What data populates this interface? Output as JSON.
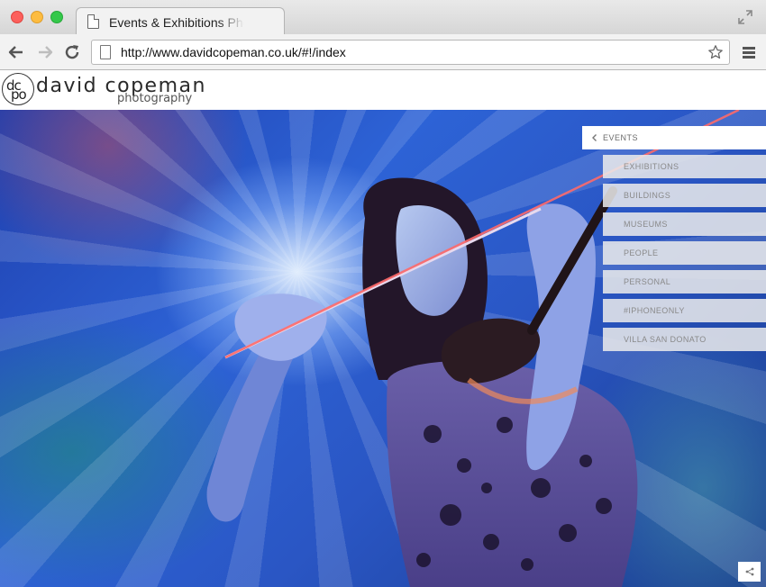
{
  "browser": {
    "tab_title": "Events & Exhibitions Photography",
    "url": "http://www.davidcopeman.co.uk/#!/index"
  },
  "site": {
    "logo_mark_top": "dc",
    "logo_mark_bottom": "po",
    "name": "david copeman",
    "tagline": "photography"
  },
  "menu": {
    "header": "EVENTS",
    "items": [
      {
        "label": "EXHIBITIONS"
      },
      {
        "label": "BUILDINGS"
      },
      {
        "label": "MUSEUMS"
      },
      {
        "label": "PEOPLE"
      },
      {
        "label": "PERSONAL"
      },
      {
        "label": "#IPHONEONLY"
      },
      {
        "label": "VILLA SAN DONATO"
      }
    ]
  },
  "icons": {
    "tab": "document-icon",
    "back": "back-arrow-icon",
    "forward": "forward-arrow-icon",
    "reload": "reload-icon",
    "bookmark": "star-icon",
    "menu": "hamburger-menu-icon",
    "fullscreen": "fullscreen-icon",
    "share": "share-icon",
    "menu_back": "chevron-left-icon"
  },
  "hero": {
    "subject": "violinist-photo"
  }
}
